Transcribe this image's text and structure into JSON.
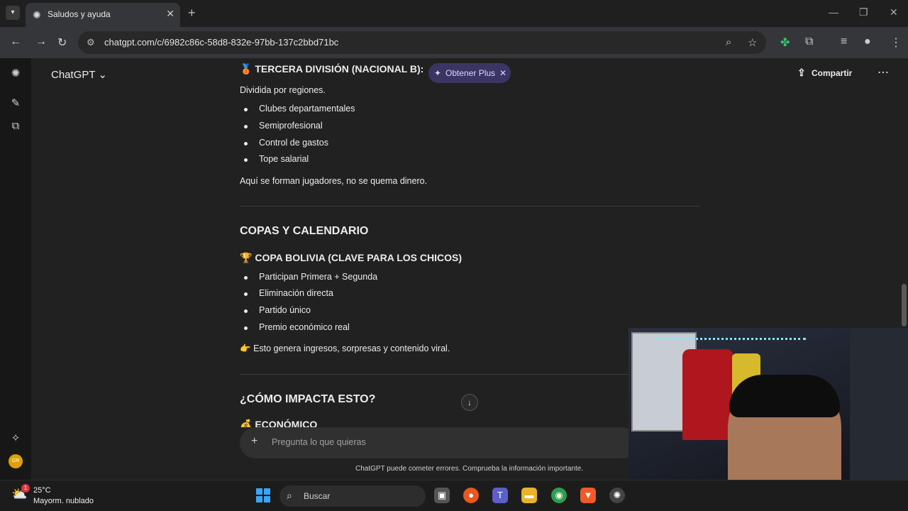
{
  "browser": {
    "tab_title": "Saludos y ayuda",
    "url": "chatgpt.com/c/6982c86c-58d8-832e-97bb-137c2bbd71bc"
  },
  "header": {
    "model": "ChatGPT ⌄",
    "plus_label": "Obtener Plus",
    "share_label": "Compartir"
  },
  "conversation": {
    "tercera_title": "TERCERA DIVISIÓN (NACIONAL B):",
    "tercera_icon": "🥉",
    "dividida": "Dividida por regiones.",
    "tercera_items": [
      "Clubes departamentales",
      "Semiprofesional",
      "Control de gastos",
      "Tope salarial"
    ],
    "aqui": "Aquí se forman jugadores, no se quema dinero.",
    "copas_heading": "COPAS Y CALENDARIO",
    "copa_icon": "🏆",
    "copa_title": "COPA BOLIVIA (CLAVE PARA LOS CHICOS)",
    "copa_items": [
      "Participan Primera + Segunda",
      "Eliminación directa",
      "Partido único",
      "Premio económico real"
    ],
    "pointer_icon": "👉",
    "genera": "Esto genera ingresos, sorpresas y contenido viral.",
    "impacta_heading": "¿CÓMO IMPACTA ESTO?",
    "econ_icon": "💰",
    "econ_heading": "ECONÓMICO"
  },
  "composer": {
    "placeholder": "Pregunta lo que quieras"
  },
  "disclaimer": "ChatGPT puede cometer errores. Comprueba la información importante.",
  "taskbar": {
    "temperature": "25°C",
    "weather": "Mayorm. nublado",
    "weather_badge": "1",
    "search_label": "Buscar"
  },
  "colors": {
    "accent_plus": "#3b3563",
    "background": "#212121"
  }
}
